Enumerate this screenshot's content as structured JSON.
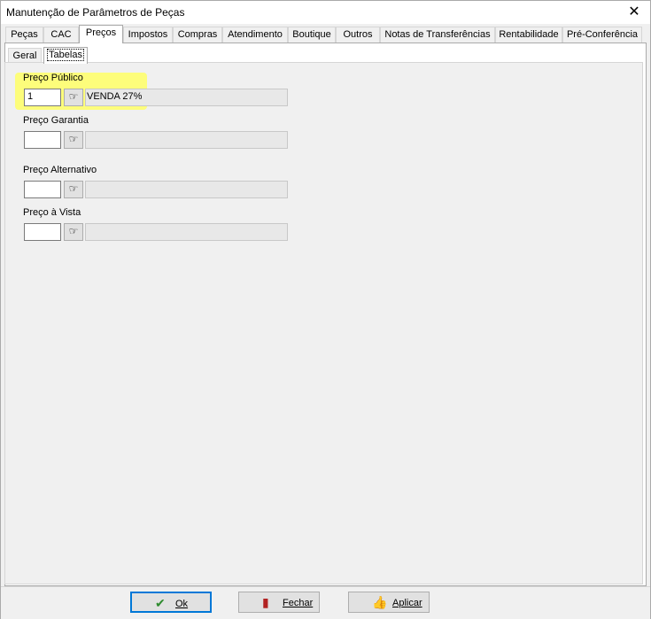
{
  "window": {
    "title": "Manutenção de Parâmetros de Peças"
  },
  "tabs": [
    "Peças",
    "CAC",
    "Preços",
    "Impostos",
    "Compras",
    "Atendimento",
    "Boutique",
    "Outros",
    "Notas de Transferências",
    "Rentabilidade",
    "Pré-Conferência"
  ],
  "active_tab": "Preços",
  "subtabs": [
    "Geral",
    "Tabelas"
  ],
  "active_subtab": "Tabelas",
  "price_groups": [
    {
      "label": "Preço Público",
      "code": "1",
      "description": "VENDA 27%"
    },
    {
      "label": "Preço Garantia",
      "code": "",
      "description": ""
    },
    {
      "label": "Preço Alternativo",
      "code": "",
      "description": ""
    },
    {
      "label": "Preço à Vista",
      "code": "",
      "description": ""
    }
  ],
  "buttons": {
    "ok": "Ok",
    "close": "Fechar",
    "apply": "Aplicar"
  },
  "icons": {
    "close": "close-icon",
    "pick": "pointing-hand-icon",
    "ok": "checkmark-icon",
    "fechar": "exit-door-icon",
    "aplicar": "thumbs-up-icon"
  },
  "colors": {
    "highlight": "#ffff66",
    "default_button_border": "#0078d7"
  }
}
